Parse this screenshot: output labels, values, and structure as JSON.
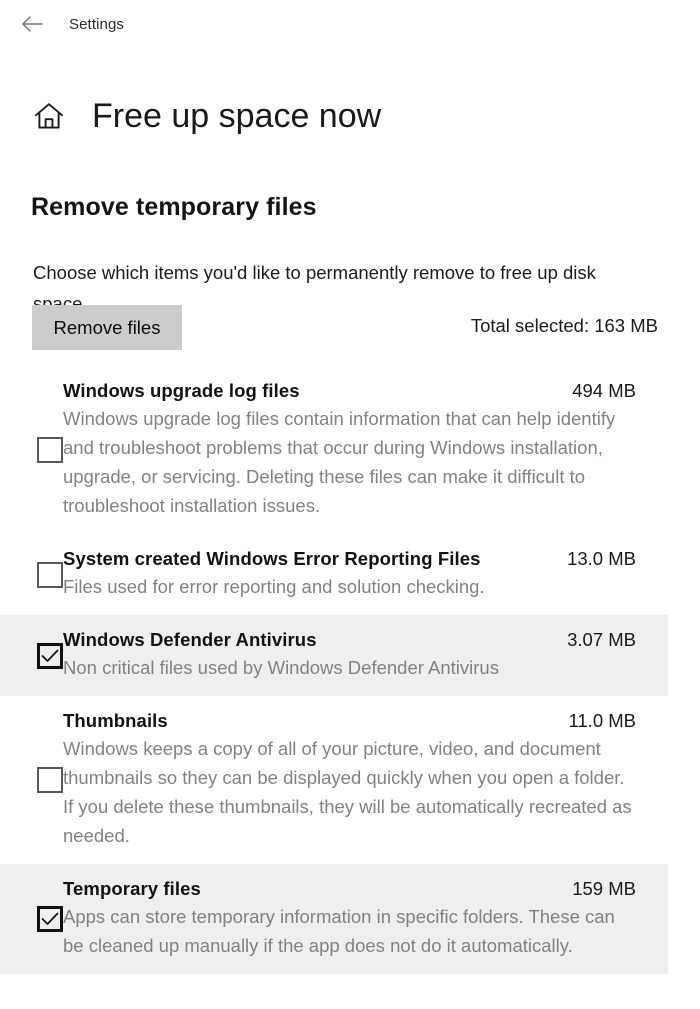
{
  "titlebar": {
    "back_icon": "back-arrow-icon",
    "app_title": "Settings"
  },
  "header": {
    "home_icon": "home-icon",
    "page_title": "Free up space now"
  },
  "section": {
    "title": "Remove temporary files",
    "description": "Choose which items you'd like to permanently remove to free up disk space."
  },
  "actions": {
    "remove_files_label": "Remove files",
    "total_selected_label": "Total selected: 163 MB"
  },
  "colors": {
    "page_background": "#ffffff",
    "selected_row_background": "#efeff0",
    "button_background": "#cccccc",
    "title_text": "#121212",
    "description_text": "#828282",
    "app_title_text": "#2b2b2b"
  },
  "items": [
    {
      "title": "Windows upgrade log files",
      "size": "494 MB",
      "description": "Windows upgrade log files contain information that can help identify and troubleshoot problems that occur during Windows installation, upgrade, or servicing.  Deleting these files can make it difficult to troubleshoot installation issues.",
      "checked": false,
      "highlighted": false
    },
    {
      "title": "System created Windows Error Reporting Files",
      "size": "13.0 MB",
      "description": "Files used for error reporting and solution checking.",
      "checked": false,
      "highlighted": false
    },
    {
      "title": "Windows Defender Antivirus",
      "size": "3.07 MB",
      "description": "Non critical files used by Windows Defender Antivirus",
      "checked": true,
      "highlighted": true
    },
    {
      "title": "Thumbnails",
      "size": "11.0 MB",
      "description": "Windows keeps a copy of all of your picture, video, and document thumbnails so they can be displayed quickly when you open a folder. If you delete these thumbnails, they will be automatically recreated as needed.",
      "checked": false,
      "highlighted": false
    },
    {
      "title": "Temporary files",
      "size": "159 MB",
      "description": "Apps can store temporary information in specific folders. These can be cleaned up manually if the app does not do it automatically.",
      "checked": true,
      "highlighted": true
    }
  ]
}
